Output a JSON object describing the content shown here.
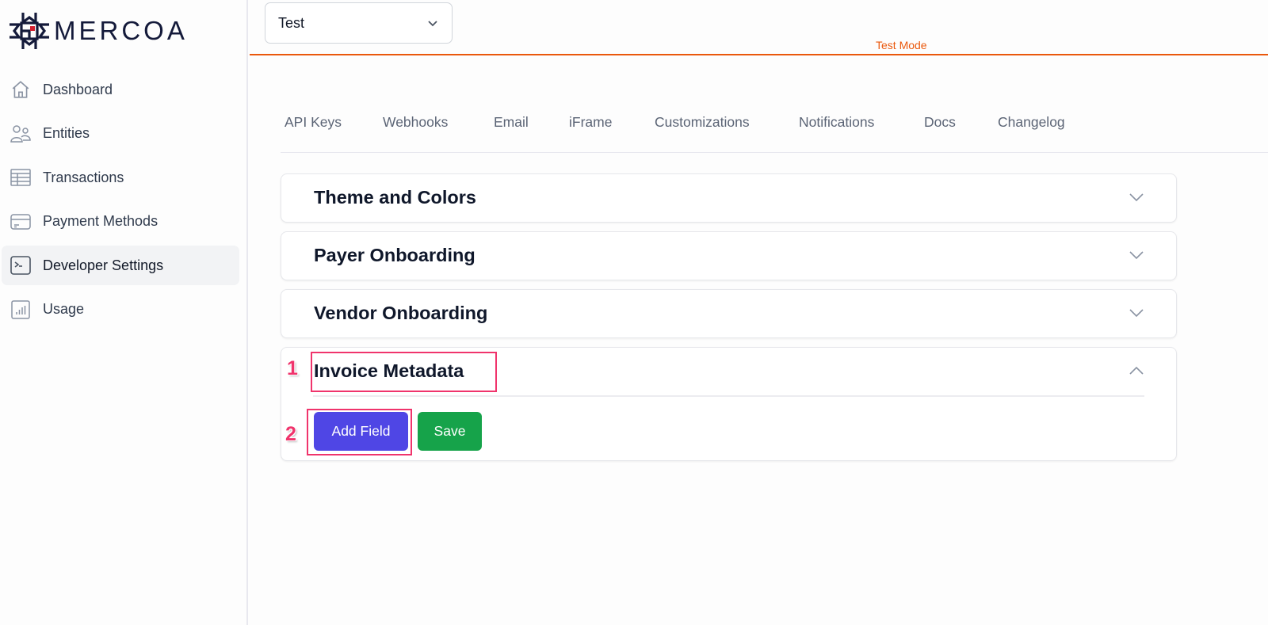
{
  "brand": {
    "name": "MERCOA",
    "accent": "#ea580c",
    "primary": "#4f46e5",
    "success": "#16a34a",
    "annotation": "#f0346c"
  },
  "sidebar": {
    "items": [
      {
        "label": "Dashboard",
        "icon": "home-icon",
        "active": false
      },
      {
        "label": "Entities",
        "icon": "users-icon",
        "active": false
      },
      {
        "label": "Transactions",
        "icon": "table-icon",
        "active": false
      },
      {
        "label": "Payment Methods",
        "icon": "credit-card-icon",
        "active": false
      },
      {
        "label": "Developer Settings",
        "icon": "terminal-icon",
        "active": true
      },
      {
        "label": "Usage",
        "icon": "bar-chart-icon",
        "active": false
      }
    ]
  },
  "topbar": {
    "environment_select": {
      "value": "Test"
    },
    "mode_label": "Test Mode"
  },
  "tabs": [
    {
      "label": "API Keys"
    },
    {
      "label": "Webhooks"
    },
    {
      "label": "Email"
    },
    {
      "label": "iFrame"
    },
    {
      "label": "Customizations"
    },
    {
      "label": "Notifications"
    },
    {
      "label": "Docs"
    },
    {
      "label": "Changelog"
    }
  ],
  "sections": [
    {
      "title": "Theme and Colors",
      "expanded": false
    },
    {
      "title": "Payer Onboarding",
      "expanded": false
    },
    {
      "title": "Vendor Onboarding",
      "expanded": false
    },
    {
      "title": "Invoice Metadata",
      "expanded": true
    }
  ],
  "invoice_metadata": {
    "add_field_label": "Add Field",
    "save_label": "Save"
  },
  "annotations": [
    {
      "number": "1",
      "target": "Invoice Metadata"
    },
    {
      "number": "2",
      "target": "Add Field"
    }
  ]
}
